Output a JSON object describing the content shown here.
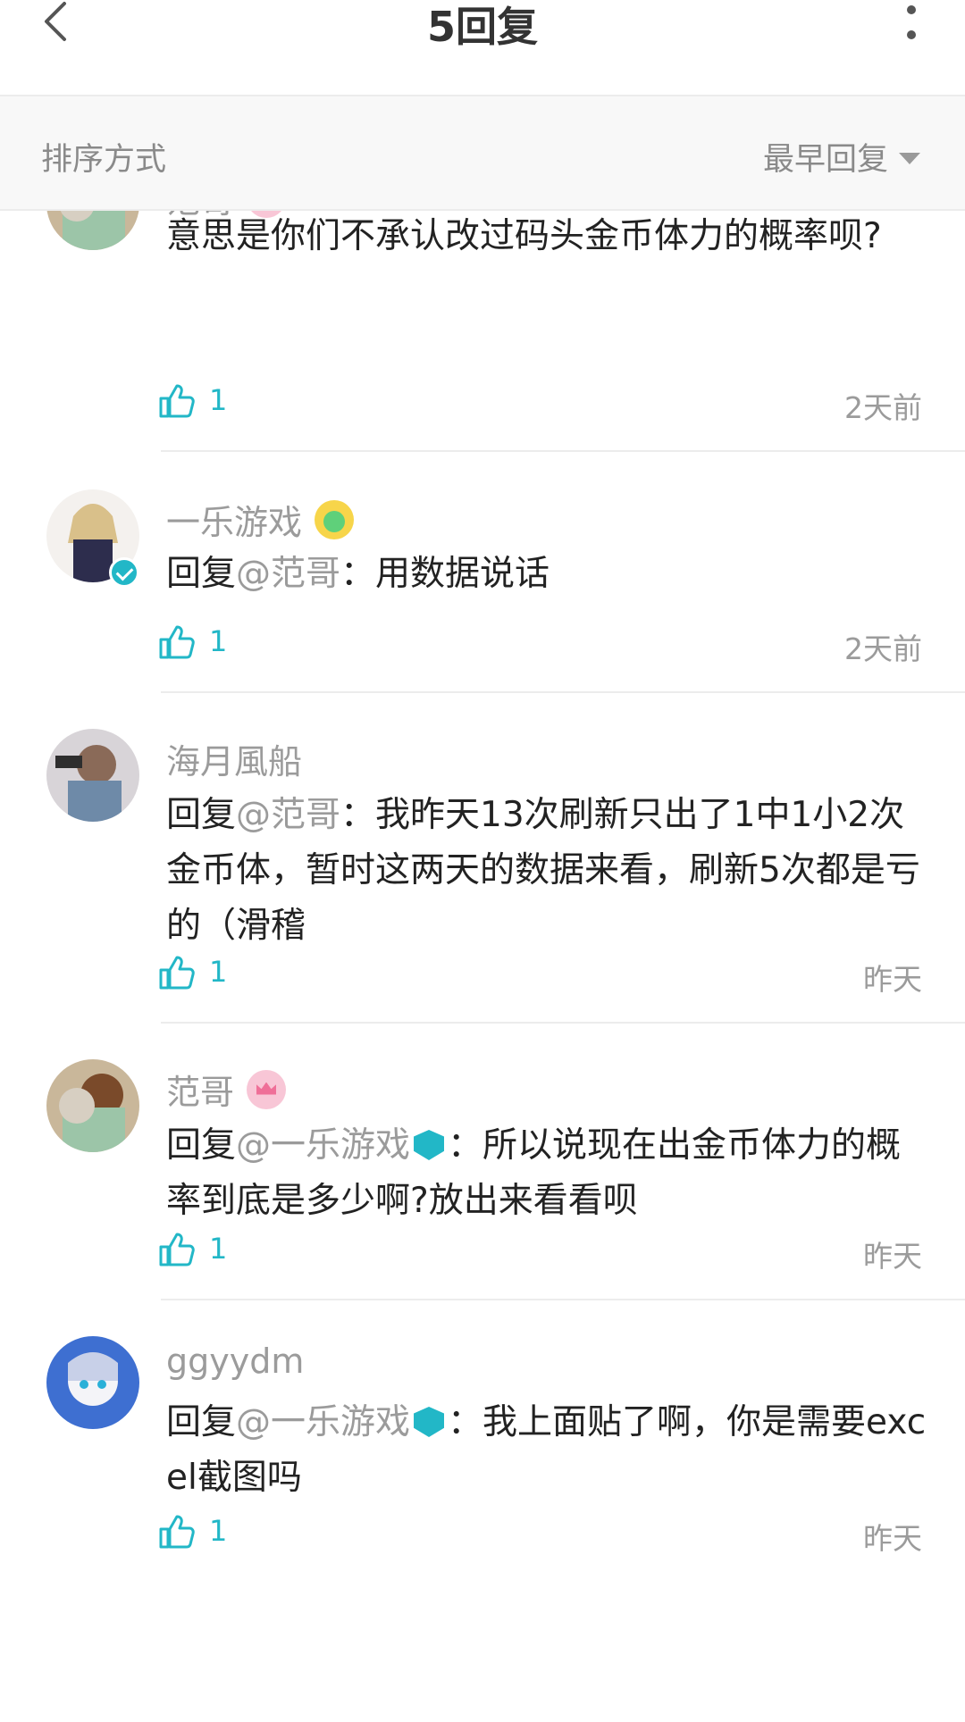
{
  "header": {
    "title": "5回复"
  },
  "sort": {
    "label": "排序方式",
    "value": "最早回复"
  },
  "comments": [
    {
      "username": "范哥",
      "text": "意思是你们不承认改过码头金币体力的概率呗?",
      "likes": "1",
      "time": "2天前"
    },
    {
      "username": "一乐游戏",
      "reply_prefix": "回复",
      "mention": "@范哥",
      "colon": "：",
      "text": "用数据说话",
      "likes": "1",
      "time": "2天前"
    },
    {
      "username": "海月風船",
      "reply_prefix": "回复",
      "mention": "@范哥",
      "colon": "：",
      "text": "我昨天13次刷新只出了1中1小2次金币体，暂时这两天的数据来看，刷新5次都是亏的（滑稽",
      "likes": "1",
      "time": "昨天"
    },
    {
      "username": "范哥",
      "reply_prefix": "回复",
      "mention": "@一乐游戏",
      "colon": "：",
      "text": "所以说现在出金币体力的概率到底是多少啊?放出来看看呗",
      "likes": "1",
      "time": "昨天"
    },
    {
      "username": "ggyydm",
      "reply_prefix": "回复",
      "mention": "@一乐游戏",
      "colon": "：",
      "text": "我上面贴了啊，你是需要excel截图吗",
      "likes": "1",
      "time": "昨天"
    }
  ],
  "colors": {
    "accent": "#22b7c7",
    "muted": "#9b9b9b",
    "crown": "#ef6f98"
  }
}
